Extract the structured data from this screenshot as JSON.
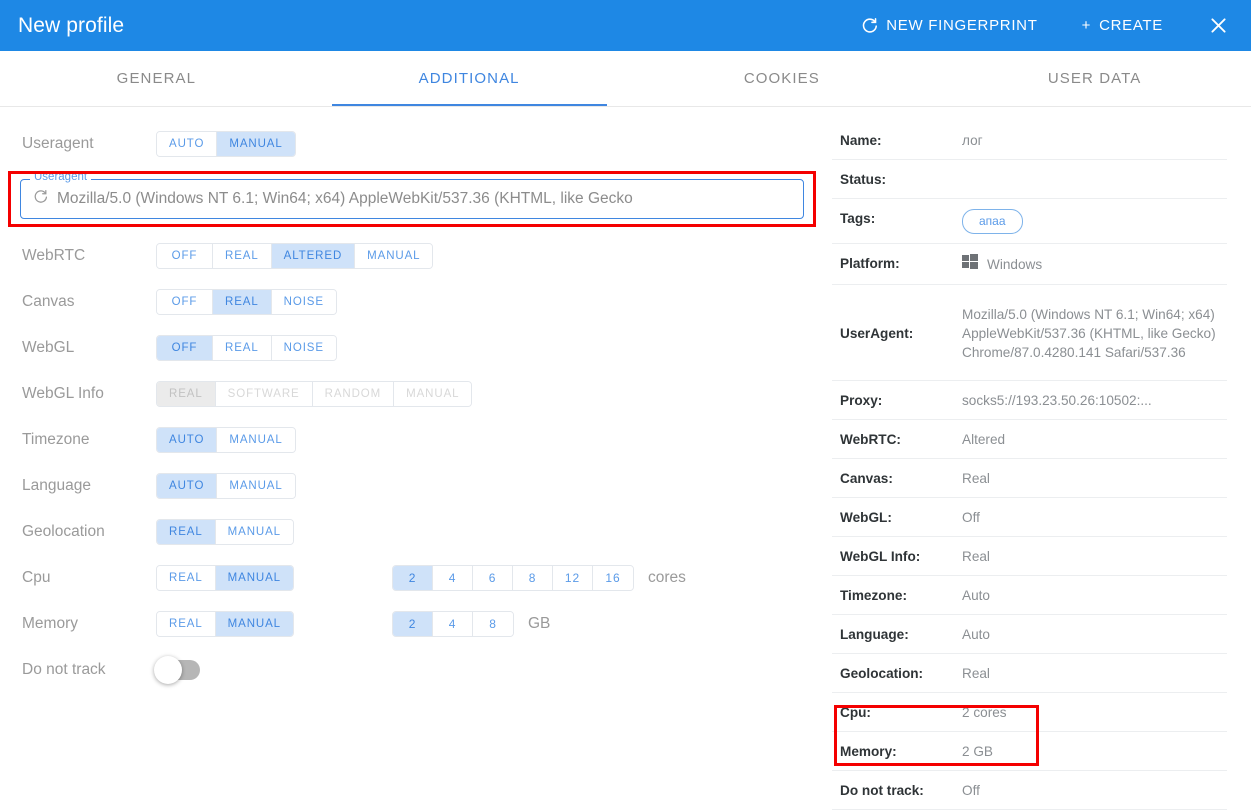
{
  "header": {
    "title": "New profile",
    "new_fingerprint_label": "NEW FINGERPRINT",
    "create_label": "CREATE",
    "create_prefix": "+",
    "close_label": "✕"
  },
  "tabs": [
    {
      "label": "GENERAL",
      "active": false
    },
    {
      "label": "ADDITIONAL",
      "active": true
    },
    {
      "label": "COOKIES",
      "active": false
    },
    {
      "label": "USER DATA",
      "active": false
    }
  ],
  "settings": {
    "useragent": {
      "label": "Useragent",
      "options": [
        "AUTO",
        "MANUAL"
      ],
      "selected": "MANUAL",
      "field_legend": "Useragent",
      "field_value": "Mozilla/5.0 (Windows NT 6.1; Win64; x64) AppleWebKit/537.36 (KHTML, like Gecko"
    },
    "webrtc": {
      "label": "WebRTC",
      "options": [
        "OFF",
        "REAL",
        "ALTERED",
        "MANUAL"
      ],
      "selected": "ALTERED"
    },
    "canvas": {
      "label": "Canvas",
      "options": [
        "OFF",
        "REAL",
        "NOISE"
      ],
      "selected": "REAL"
    },
    "webgl": {
      "label": "WebGL",
      "options": [
        "OFF",
        "REAL",
        "NOISE"
      ],
      "selected": "OFF"
    },
    "webgl_info": {
      "label": "WebGL Info",
      "options": [
        "REAL",
        "SOFTWARE",
        "RANDOM",
        "MANUAL"
      ],
      "selected": "REAL",
      "disabled": true
    },
    "timezone": {
      "label": "Timezone",
      "options": [
        "AUTO",
        "MANUAL"
      ],
      "selected": "AUTO"
    },
    "language": {
      "label": "Language",
      "options": [
        "AUTO",
        "MANUAL"
      ],
      "selected": "AUTO"
    },
    "geolocation": {
      "label": "Geolocation",
      "options": [
        "REAL",
        "MANUAL"
      ],
      "selected": "REAL"
    },
    "cpu": {
      "label": "Cpu",
      "options": [
        "REAL",
        "MANUAL"
      ],
      "selected": "MANUAL",
      "values": [
        "2",
        "4",
        "6",
        "8",
        "12",
        "16"
      ],
      "value_selected": "2",
      "unit": "cores"
    },
    "memory": {
      "label": "Memory",
      "options": [
        "REAL",
        "MANUAL"
      ],
      "selected": "MANUAL",
      "values": [
        "2",
        "4",
        "8"
      ],
      "value_selected": "2",
      "unit": "GB"
    },
    "do_not_track": {
      "label": "Do not track",
      "on": false
    }
  },
  "summary": {
    "rows": [
      {
        "key": "Name:",
        "value": "лог",
        "type": "text"
      },
      {
        "key": "Status:",
        "value": "",
        "type": "text"
      },
      {
        "key": "Tags:",
        "value": "апаа",
        "type": "tag"
      },
      {
        "key": "Platform:",
        "value": "Windows",
        "type": "platform"
      },
      {
        "key": "UserAgent:",
        "value": "Mozilla/5.0 (Windows NT 6.1; Win64; x64) AppleWebKit/537.36 (KHTML, like Gecko) Chrome/87.0.4280.141 Safari/537.36",
        "type": "tall"
      },
      {
        "key": "Proxy:",
        "value": "socks5://193.23.50.26:10502:...",
        "type": "text"
      },
      {
        "key": "WebRTC:",
        "value": "Altered",
        "type": "text"
      },
      {
        "key": "Canvas:",
        "value": "Real",
        "type": "text"
      },
      {
        "key": "WebGL:",
        "value": "Off",
        "type": "text"
      },
      {
        "key": "WebGL Info:",
        "value": "Real",
        "type": "text"
      },
      {
        "key": "Timezone:",
        "value": "Auto",
        "type": "text"
      },
      {
        "key": "Language:",
        "value": "Auto",
        "type": "text"
      },
      {
        "key": "Geolocation:",
        "value": "Real",
        "type": "text"
      },
      {
        "key": "Cpu:",
        "value": "2 cores",
        "type": "text"
      },
      {
        "key": "Memory:",
        "value": "2 GB",
        "type": "text"
      },
      {
        "key": "Do not track:",
        "value": "Off",
        "type": "text"
      }
    ]
  },
  "annotations": {
    "highlight_color": "#f40000",
    "useragent_box": "useragent-field-highlight",
    "cpu_memory_box": "cpu-memory-rows-highlight"
  },
  "colors": {
    "header_blue": "#1e88e5",
    "accent_blue": "#3f86e0",
    "segment_active_bg": "#cfe2f9",
    "label_gray": "#9a9a9a"
  }
}
